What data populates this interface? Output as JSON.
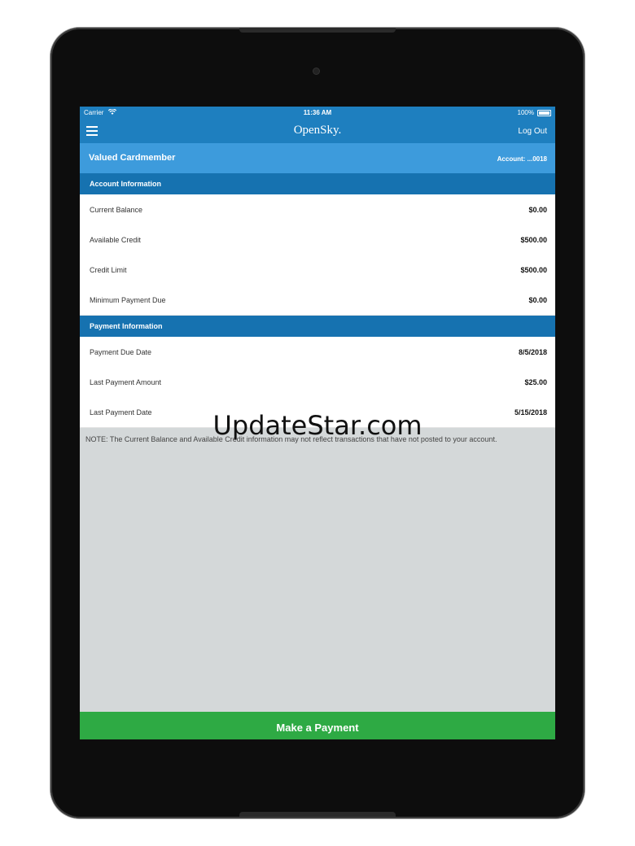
{
  "status_bar": {
    "carrier": "Carrier",
    "time": "11:36 AM",
    "battery": "100%"
  },
  "nav": {
    "brand": "OpenSky.",
    "logout": "Log Out"
  },
  "member": {
    "name": "Valued Cardmember",
    "account": "Account: ...0018"
  },
  "account_info": {
    "title": "Account Information",
    "rows": [
      {
        "label": "Current Balance",
        "value": "$0.00"
      },
      {
        "label": "Available Credit",
        "value": "$500.00"
      },
      {
        "label": "Credit Limit",
        "value": "$500.00"
      },
      {
        "label": "Minimum Payment Due",
        "value": "$0.00"
      }
    ]
  },
  "payment_info": {
    "title": "Payment Information",
    "rows": [
      {
        "label": "Payment Due Date",
        "value": "8/5/2018"
      },
      {
        "label": "Last Payment Amount",
        "value": "$25.00"
      },
      {
        "label": "Last Payment Date",
        "value": "5/15/2018"
      }
    ]
  },
  "note": "NOTE: The Current Balance and Available Credit information may not reflect transactions that have not posted to your account.",
  "cta": {
    "label": "Make a Payment"
  },
  "watermark": "UpdateStar.com",
  "colors": {
    "header_blue": "#1e7fbf",
    "member_blue": "#3d9bdc",
    "section_blue": "#1672b0",
    "pay_green": "#2eaa44",
    "background_gray": "#d4d8d9"
  }
}
